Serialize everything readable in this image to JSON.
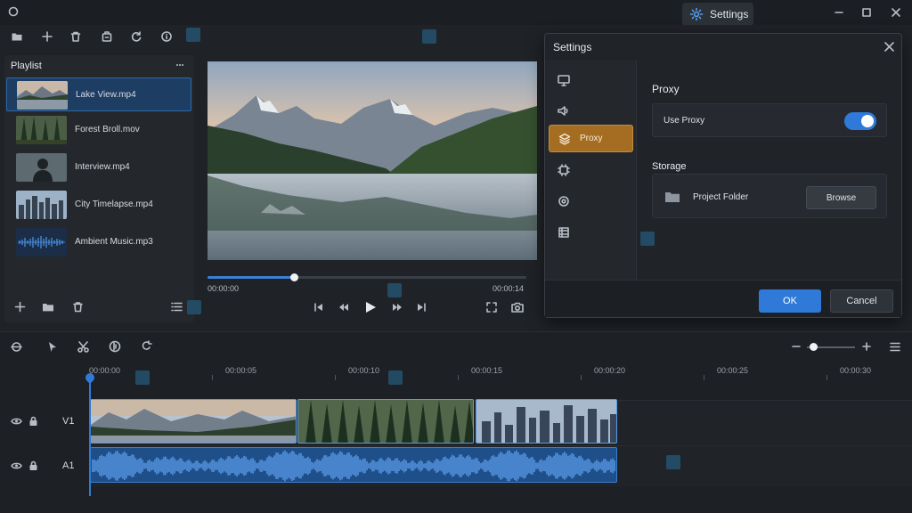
{
  "window": {
    "settings_label": "Settings"
  },
  "playlist": {
    "title": "Playlist",
    "items": [
      {
        "label": "Lake View.mp4"
      },
      {
        "label": "Forest Broll.mov"
      },
      {
        "label": "Interview.mp4"
      },
      {
        "label": "City Timelapse.mp4"
      },
      {
        "label": "Ambient Music.mp3"
      }
    ]
  },
  "preview": {
    "current_time": "00:00:00",
    "duration": "00:00:14",
    "progress": 0.27
  },
  "settings_dialog": {
    "title": "Settings",
    "sidebar_active_label": "Proxy",
    "proxy_section_title": "Proxy",
    "use_proxy_label": "Use Proxy",
    "use_proxy_enabled": true,
    "storage_section_title": "Storage",
    "project_folder_label": "Project Folder",
    "browse_label": "Browse",
    "ok_label": "OK",
    "cancel_label": "Cancel"
  },
  "timeline": {
    "ruler": [
      "00:00:00",
      "00:00:05",
      "00:00:10",
      "00:00:15",
      "00:00:20",
      "00:00:25",
      "00:00:30"
    ],
    "tracks": [
      {
        "name": "V1"
      },
      {
        "name": "A1"
      }
    ]
  },
  "colors": {
    "accent": "#2f7ad8",
    "active_sidebar": "#a56d22"
  }
}
